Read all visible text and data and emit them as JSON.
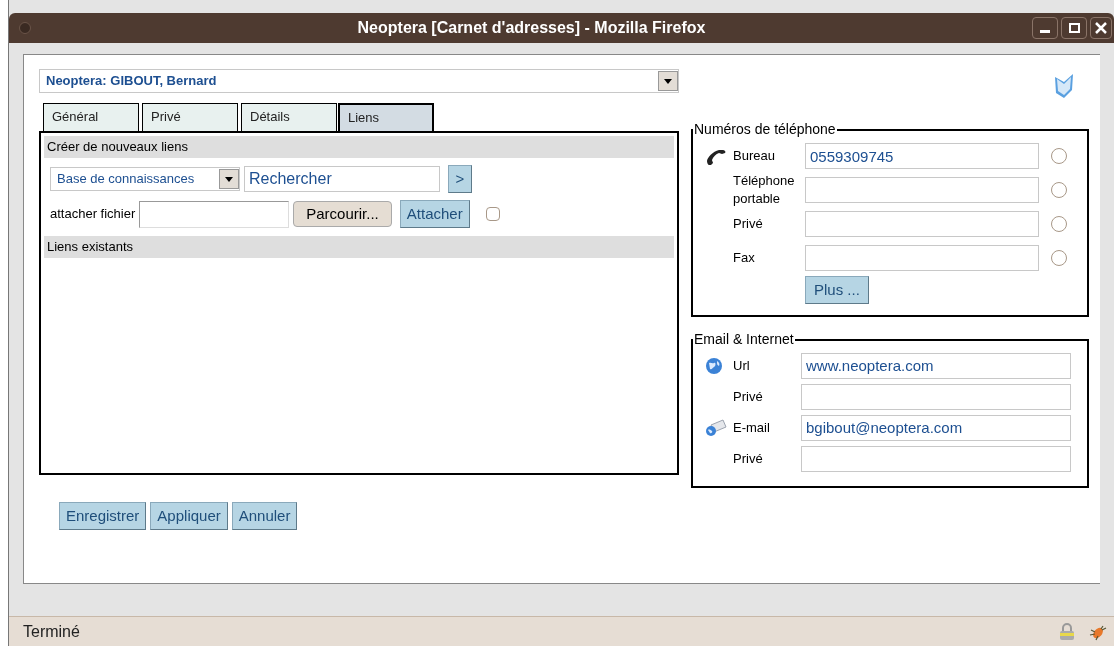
{
  "window": {
    "title": "Neoptera [Carnet d'adresses] - Mozilla Firefox"
  },
  "contact_select": {
    "value": "Neoptera: GIBOUT, Bernard"
  },
  "tabs": [
    {
      "label": "Général",
      "selected": false
    },
    {
      "label": "Privé",
      "selected": false
    },
    {
      "label": "Détails",
      "selected": false
    },
    {
      "label": "Liens",
      "selected": true
    }
  ],
  "links_panel": {
    "create_heading": "Créer de nouveaux liens",
    "type_select": "Base de connaissances",
    "search_field": {
      "value": "Rechercher"
    },
    "go_button": ">",
    "attach_label": "attacher fichier",
    "browse_button": "Parcourir...",
    "attach_button": "Attacher",
    "attach_checkbox": {
      "checked": false
    },
    "existing_heading": "Liens existants"
  },
  "phones": {
    "legend": "Numéros de téléphone",
    "rows": [
      {
        "label": "Bureau",
        "value": "0559309745",
        "kind": "phone",
        "selected": false
      },
      {
        "label": "Téléphone portable",
        "value": "",
        "selected": false
      },
      {
        "label": "Privé",
        "value": "",
        "selected": false
      },
      {
        "label": "Fax",
        "value": "",
        "selected": false
      }
    ],
    "more_button": "Plus ..."
  },
  "internet": {
    "legend": "Email & Internet",
    "rows": [
      {
        "label": "Url",
        "value": "www.neoptera.com",
        "kind": "globe"
      },
      {
        "label": "Privé",
        "value": ""
      },
      {
        "label": "E-mail",
        "value": "bgibout@neoptera.com",
        "kind": "mail"
      },
      {
        "label": "Privé",
        "value": ""
      }
    ]
  },
  "buttons": [
    "Enregistrer",
    "Appliquer",
    "Annuler"
  ],
  "status_bar": {
    "text": "Terminé"
  }
}
